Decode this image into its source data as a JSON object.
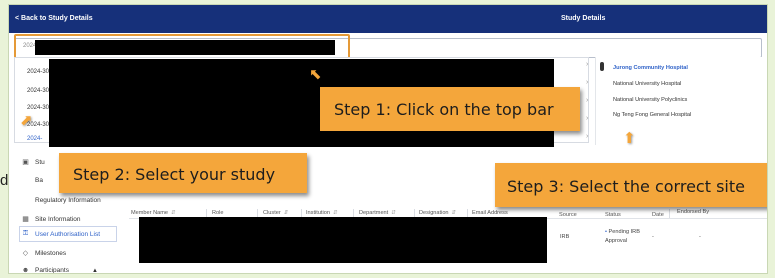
{
  "topbar": {
    "back_label": "< Back to Study Details",
    "title": "Study Details"
  },
  "search": {
    "value": "2024"
  },
  "dropdown": {
    "items": [
      {
        "label": "2024-30"
      },
      {
        "label": "2024-30"
      },
      {
        "label": "2024-30"
      },
      {
        "label": "2024-30"
      },
      {
        "label": "2024-"
      }
    ]
  },
  "institutions": {
    "items": [
      "Jurong Community Hospital",
      "National University Hospital",
      "National University Polyclinics",
      "Ng Teng Fong General Hospital"
    ]
  },
  "callouts": {
    "step1": "Step 1: Click on the top bar",
    "step2": "Step 2: Select your study",
    "step3": "Step 3: Select the correct site"
  },
  "outer": {
    "letter": "d"
  },
  "sidebar": {
    "items": [
      {
        "label": "Stu",
        "icon": "book-icon"
      },
      {
        "label": "Ba"
      },
      {
        "label": "Regulatory Information"
      },
      {
        "label": "Site Information",
        "icon": "building-icon"
      },
      {
        "label": "User Authorisation List",
        "icon": "lock-icon"
      },
      {
        "label": "Milestones",
        "icon": "milestone-icon"
      },
      {
        "label": "Participants",
        "icon": "people-icon"
      }
    ]
  },
  "table": {
    "columns": [
      "Member Name",
      "Role",
      "Cluster",
      "Institution",
      "Department",
      "Designation",
      "Email Address",
      "Source",
      "Status",
      "Date",
      "Endorsed By"
    ],
    "row": {
      "source": "IRB",
      "status_line1": "Pending IRB",
      "status_line2": "Approval",
      "date": "-",
      "endorsed_by": "-"
    }
  },
  "colors": {
    "navy": "#16307a",
    "accent": "#f4a63b",
    "link": "#2f62c8",
    "backdrop": "#e9f3d8"
  }
}
